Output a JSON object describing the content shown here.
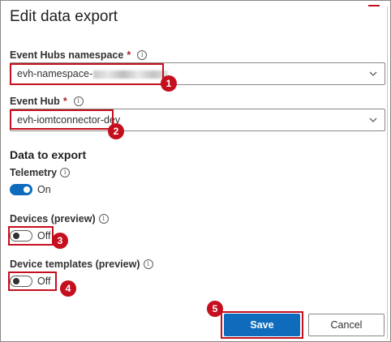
{
  "dialog": {
    "title": "Edit data export"
  },
  "namespace": {
    "label": "Event Hubs namespace",
    "required_mark": "*",
    "value": "evh-namespace-",
    "badge": "1"
  },
  "event_hub": {
    "label": "Event Hub",
    "required_mark": "*",
    "value": "evh-iomtconnector-dev",
    "badge": "2"
  },
  "data_to_export": {
    "title": "Data to export",
    "telemetry": {
      "label": "Telemetry",
      "state": "On"
    },
    "devices": {
      "label": "Devices (preview)",
      "state": "Off",
      "badge": "3"
    },
    "device_templates": {
      "label": "Device templates (preview)",
      "state": "Off",
      "badge": "4"
    }
  },
  "footer": {
    "save_label": "Save",
    "cancel_label": "Cancel",
    "save_badge": "5"
  },
  "icons": {
    "info": "info-icon",
    "chevron": "chevron-down-icon"
  },
  "colors": {
    "accent": "#0f6cbd",
    "callout": "#c50f1f"
  }
}
